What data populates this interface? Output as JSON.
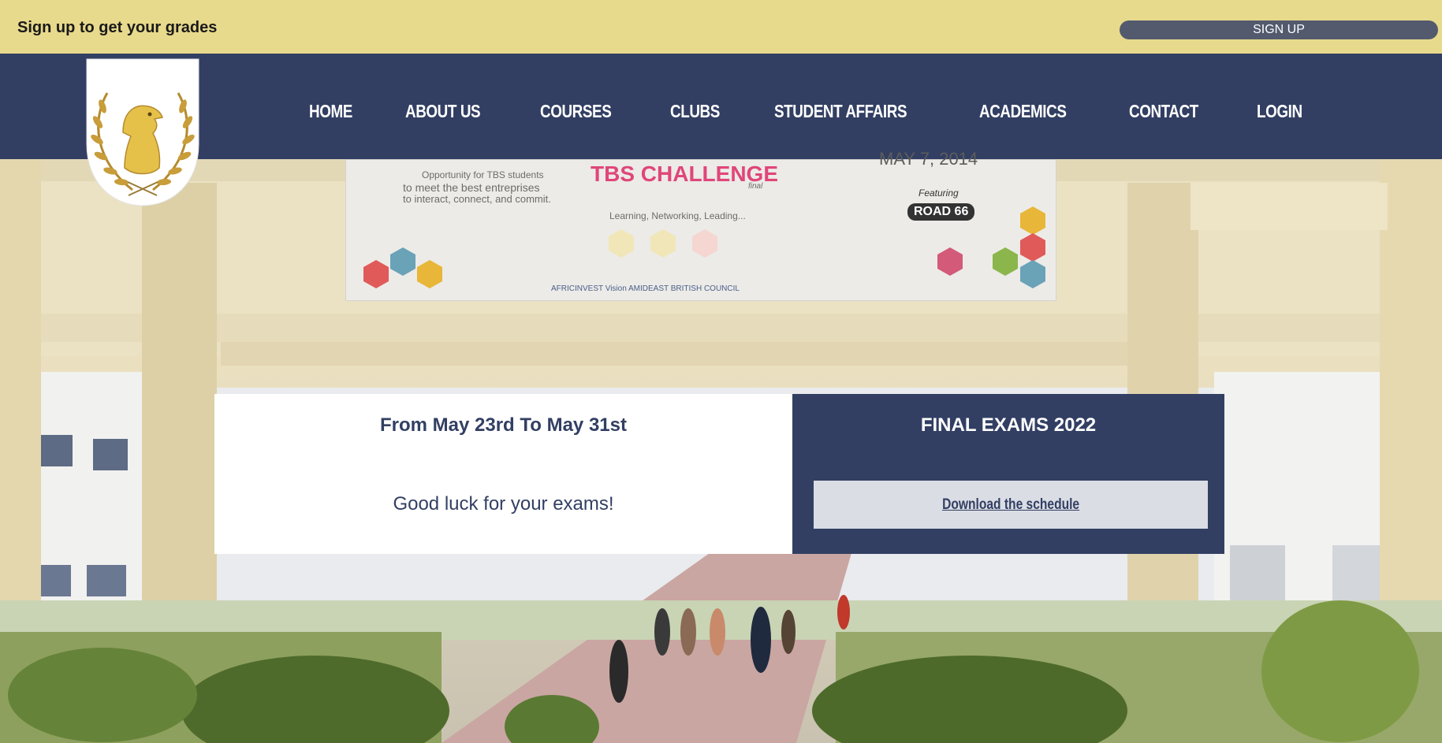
{
  "topbar": {
    "text": "Sign up to get your grades",
    "signup_label": "SIGN UP"
  },
  "nav": {
    "items": [
      "HOME",
      "ABOUT US",
      "COURSES",
      "CLUBS",
      "STUDENT AFFAIRS",
      "ACADEMICS",
      "CONTACT",
      "LOGIN"
    ]
  },
  "banner": {
    "line1": "Opportunity for TBS students",
    "line2": "to meet the best entreprises",
    "line3": "to interact, connect, and commit.",
    "title": "TBS CHALLENGE",
    "subtitle": "final",
    "date": "MAY 7, 2014",
    "tagline": "Learning, Networking, Leading...",
    "featuring": "Featuring",
    "road": "ROAD 66",
    "sponsors": "AFRICINVEST   Vision   AMIDEAST   BRITISH COUNCIL"
  },
  "card": {
    "dates": "From May 23rd To May 31st",
    "message": "Good luck for your exams!",
    "title": "FINAL EXAMS 2022",
    "download_label": "Download the schedule"
  },
  "colors": {
    "navy": "#323f63",
    "topbar": "#e8da8c",
    "gold": "#d9b441"
  },
  "icons": {
    "crest": "eagle-laurel-crest-icon"
  }
}
